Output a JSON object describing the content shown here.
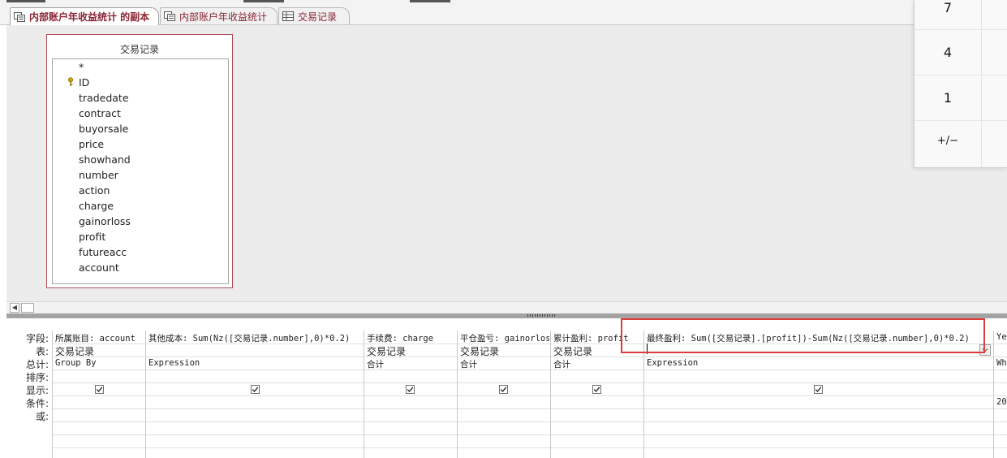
{
  "tabs": [
    {
      "label": "内部账户年收益统计 的副本",
      "active": true,
      "icon": "query-icon"
    },
    {
      "label": "内部账户年收益统计",
      "active": false,
      "icon": "query-icon"
    },
    {
      "label": "交易记录",
      "active": false,
      "icon": "table-icon"
    }
  ],
  "table_box": {
    "title": "交易记录",
    "fields": [
      "*",
      "ID",
      "tradedate",
      "contract",
      "buyorsale",
      "price",
      "showhand",
      "number",
      "action",
      "charge",
      "gainorloss",
      "profit",
      "futureacc",
      "account"
    ]
  },
  "calculator": {
    "keys": [
      "7",
      "4",
      "1",
      "+/−"
    ]
  },
  "grid": {
    "row_labels": [
      "字段:",
      "表:",
      "总计:",
      "排序:",
      "显示:",
      "条件:",
      "或:"
    ],
    "columns": [
      {
        "field": "所属账目: account",
        "table": "交易记录",
        "total": "Group By",
        "show": true
      },
      {
        "field": "其他成本: Sum(Nz([交易记录.number],0)*0.2)",
        "table": "",
        "total": "Expression",
        "show": true
      },
      {
        "field": "手续费: charge",
        "table": "交易记录",
        "total": "合计",
        "show": true
      },
      {
        "field": "平仓盈亏: gainorloss",
        "table": "交易记录",
        "total": "合计",
        "show": true
      },
      {
        "field": "累计盈利: profit",
        "table": "交易记录",
        "total": "合计",
        "show": true
      },
      {
        "field": "最终盈利: Sum([交易记录].[profit])-Sum(Nz([交易记录.number],0)*0.2)",
        "table": "",
        "total": "Expression",
        "show": true
      },
      {
        "field": "Ye",
        "table": "",
        "total": "Wh",
        "show": false,
        "criteria": "20"
      }
    ]
  },
  "colors": {
    "accent": "#8a2433",
    "highlight_box": "#e03a3a"
  }
}
